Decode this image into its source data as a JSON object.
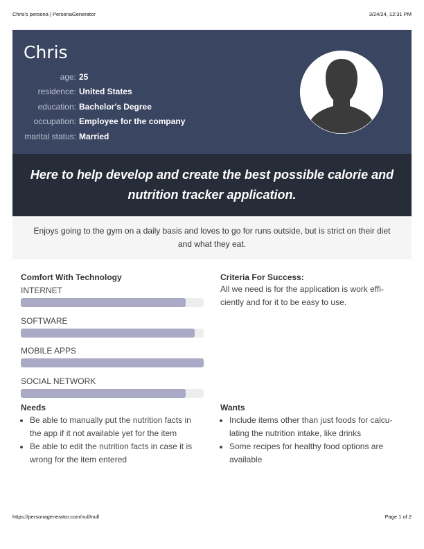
{
  "print_header": {
    "title": "Chris's persona | PersonaGenerator",
    "datetime": "3/24/24, 12:31 PM"
  },
  "persona": {
    "name": "Chris",
    "attributes": [
      {
        "label": "age:",
        "value": "25"
      },
      {
        "label": "residence:",
        "value": "United States"
      },
      {
        "label": "education:",
        "value": "Bachelor's Degree"
      },
      {
        "label": "occupation:",
        "value": "Employee for the company"
      },
      {
        "label": "marital status:",
        "value": "Married"
      }
    ],
    "avatar_icon": "user-silhouette-icon",
    "quote": "Here to help develop and create the best possible calorie and nutrition tracker application.",
    "description": "Enjoys going to the gym on a daily basis and loves to go for runs outside, but is strict on their diet and what they eat."
  },
  "comfort": {
    "title": "Comfort With Technology",
    "items": [
      {
        "label": "INTERNET",
        "level": 0.9
      },
      {
        "label": "SOFTWARE",
        "level": 0.95
      },
      {
        "label": "MOBILE APPS",
        "level": 1.0
      },
      {
        "label": "SOCIAL NETWORK",
        "level": 0.9
      }
    ]
  },
  "criteria": {
    "title": "Criteria For Success:",
    "text": "All we need is for the application is work effi­ciently and for it to be easy to use."
  },
  "needs": {
    "title": "Needs",
    "items": [
      "Be able to manually put the nutrition facts in the app if it not available yet for the item",
      "Be able to edit the nutrition facts in case it is wrong for the item entered"
    ]
  },
  "wants": {
    "title": "Wants",
    "items": [
      "Include items other than just foods for calcu­lating the nutrition intake, like drinks",
      "Some recipes for healthy food options are available"
    ]
  },
  "print_footer": {
    "url": "https://personagenerator.com/null/null",
    "page": "Page 1 of 2"
  },
  "colors": {
    "hero_bg": "#3a4561",
    "quote_bg": "#272c39",
    "bar_fill": "#aaaac6"
  }
}
